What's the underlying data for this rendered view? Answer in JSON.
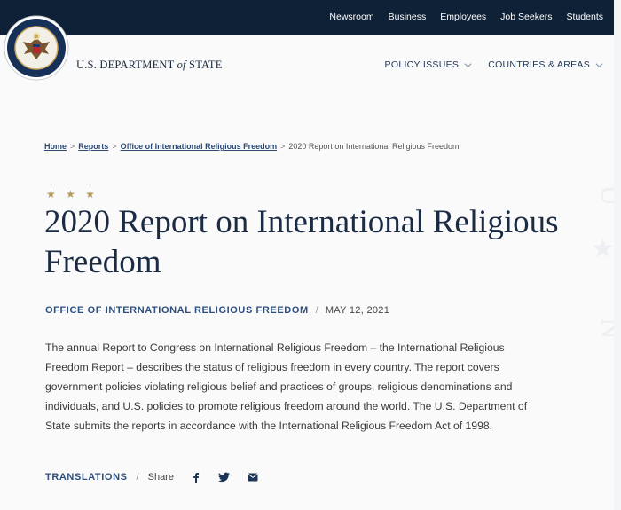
{
  "topnav": {
    "items": [
      "Newsroom",
      "Business",
      "Employees",
      "Job Seekers",
      "Students"
    ]
  },
  "header": {
    "dept_prefix": "U.S. DEPARTMENT",
    "dept_of": "of",
    "dept_suffix": "STATE",
    "nav": [
      "POLICY ISSUES",
      "COUNTRIES & AREAS"
    ]
  },
  "breadcrumb": {
    "items": [
      "Home",
      "Reports",
      "Office of International Religious Freedom"
    ],
    "current": "2020 Report on International Religious Freedom",
    "separator": ">"
  },
  "article": {
    "stars": "★ ★ ★",
    "title": "2020 Report on International Religious Freedom",
    "office": "OFFICE OF INTERNATIONAL RELIGIOUS FREEDOM",
    "meta_separator": "/",
    "date": "MAY 12, 2021",
    "description": "The annual Report to Congress on International Religious Freedom – the International Religious Freedom Report – describes the status of religious freedom in every country. The report covers government policies violating religious belief and practices of groups, religious denominations and individuals, and U.S. policies to promote religious freedom around the world. The U.S. Department of State submits the reports in accordance with the International Religious Freedom Act of 1998."
  },
  "share": {
    "translations": "TRANSLATIONS",
    "separator": "/",
    "label": "Share",
    "icons": [
      "facebook-icon",
      "twitter-icon",
      "email-icon"
    ]
  },
  "colors": {
    "topbar": "#0f2136",
    "accent_blue": "#2d4f80",
    "title": "#1b2b44",
    "gold_stars": "#b69a5b"
  }
}
